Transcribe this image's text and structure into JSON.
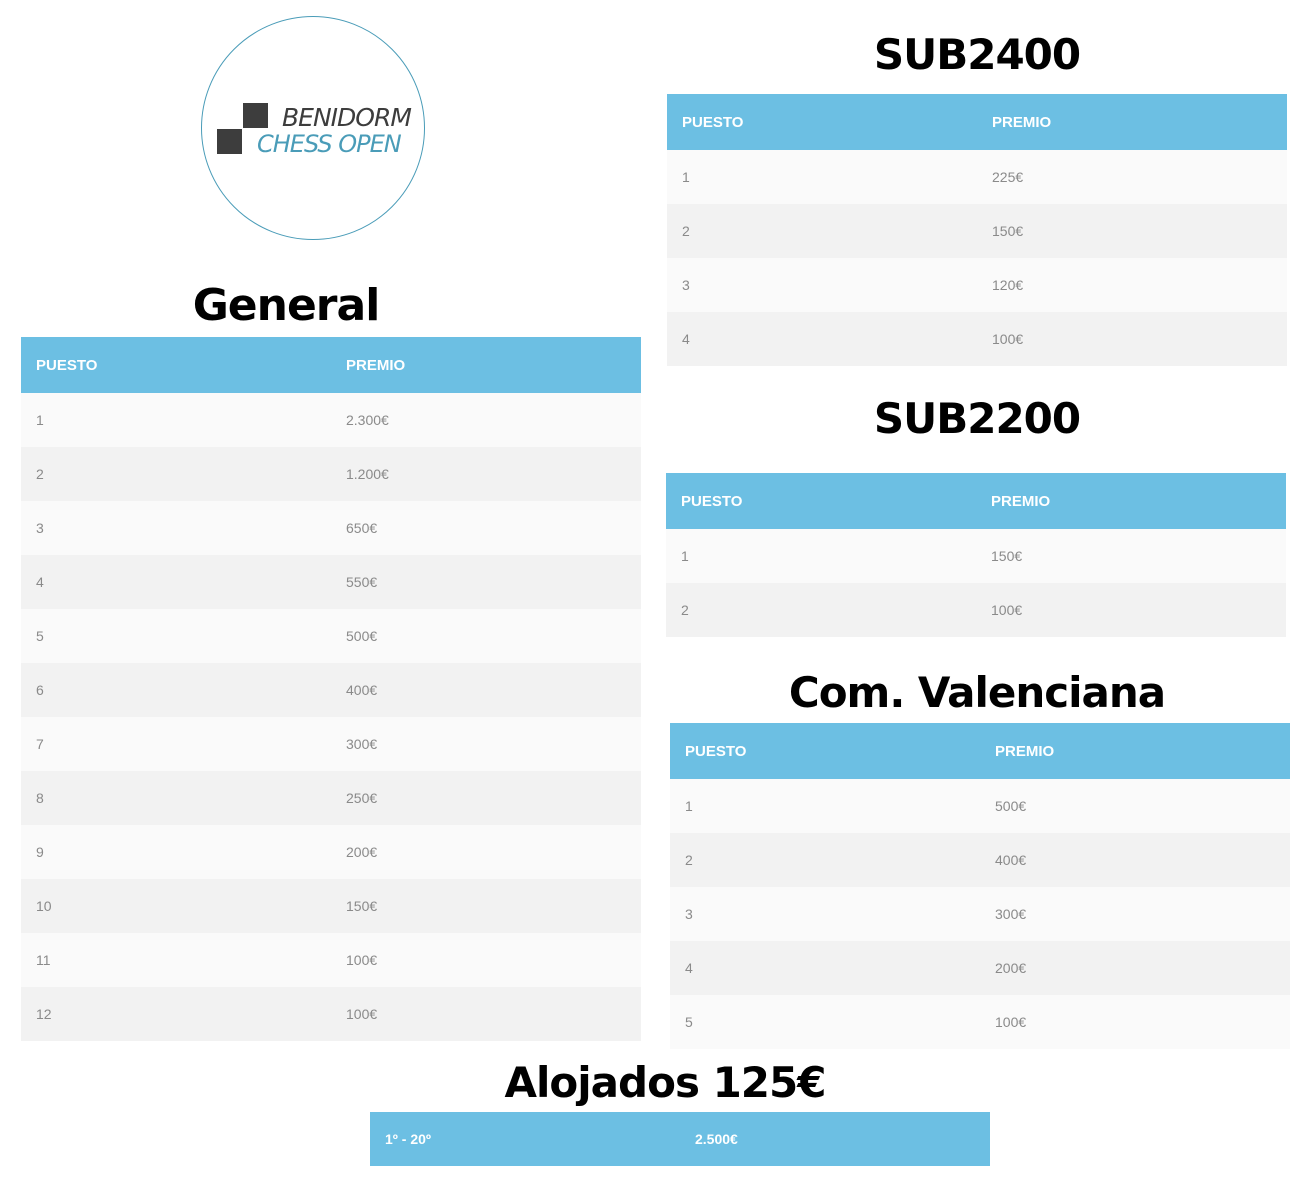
{
  "logo": {
    "line1": "BENIDORM",
    "line2": "CHESS OPEN"
  },
  "general": {
    "title": "General",
    "headers": [
      "PUESTO",
      "PREMIO"
    ],
    "rows": [
      [
        "1",
        "2.300€"
      ],
      [
        "2",
        "1.200€"
      ],
      [
        "3",
        "650€"
      ],
      [
        "4",
        "550€"
      ],
      [
        "5",
        "500€"
      ],
      [
        "6",
        "400€"
      ],
      [
        "7",
        "300€"
      ],
      [
        "8",
        "250€"
      ],
      [
        "9",
        "200€"
      ],
      [
        "10",
        "150€"
      ],
      [
        "11",
        "100€"
      ],
      [
        "12",
        "100€"
      ]
    ]
  },
  "sub2400": {
    "title": "SUB2400",
    "headers": [
      "PUESTO",
      "PREMIO"
    ],
    "rows": [
      [
        "1",
        "225€"
      ],
      [
        "2",
        "150€"
      ],
      [
        "3",
        "120€"
      ],
      [
        "4",
        "100€"
      ]
    ]
  },
  "sub2200": {
    "title": "SUB2200",
    "headers": [
      "PUESTO",
      "PREMIO"
    ],
    "rows": [
      [
        "1",
        "150€"
      ],
      [
        "2",
        "100€"
      ]
    ]
  },
  "valenciana": {
    "title": "Com. Valenciana",
    "headers": [
      "PUESTO",
      "PREMIO"
    ],
    "rows": [
      [
        "1",
        "500€"
      ],
      [
        "2",
        "400€"
      ],
      [
        "3",
        "300€"
      ],
      [
        "4",
        "200€"
      ],
      [
        "5",
        "100€"
      ]
    ]
  },
  "alojados": {
    "title": "Alojados 125€",
    "rows": [
      [
        "1º - 20º",
        "2.500€"
      ]
    ]
  }
}
